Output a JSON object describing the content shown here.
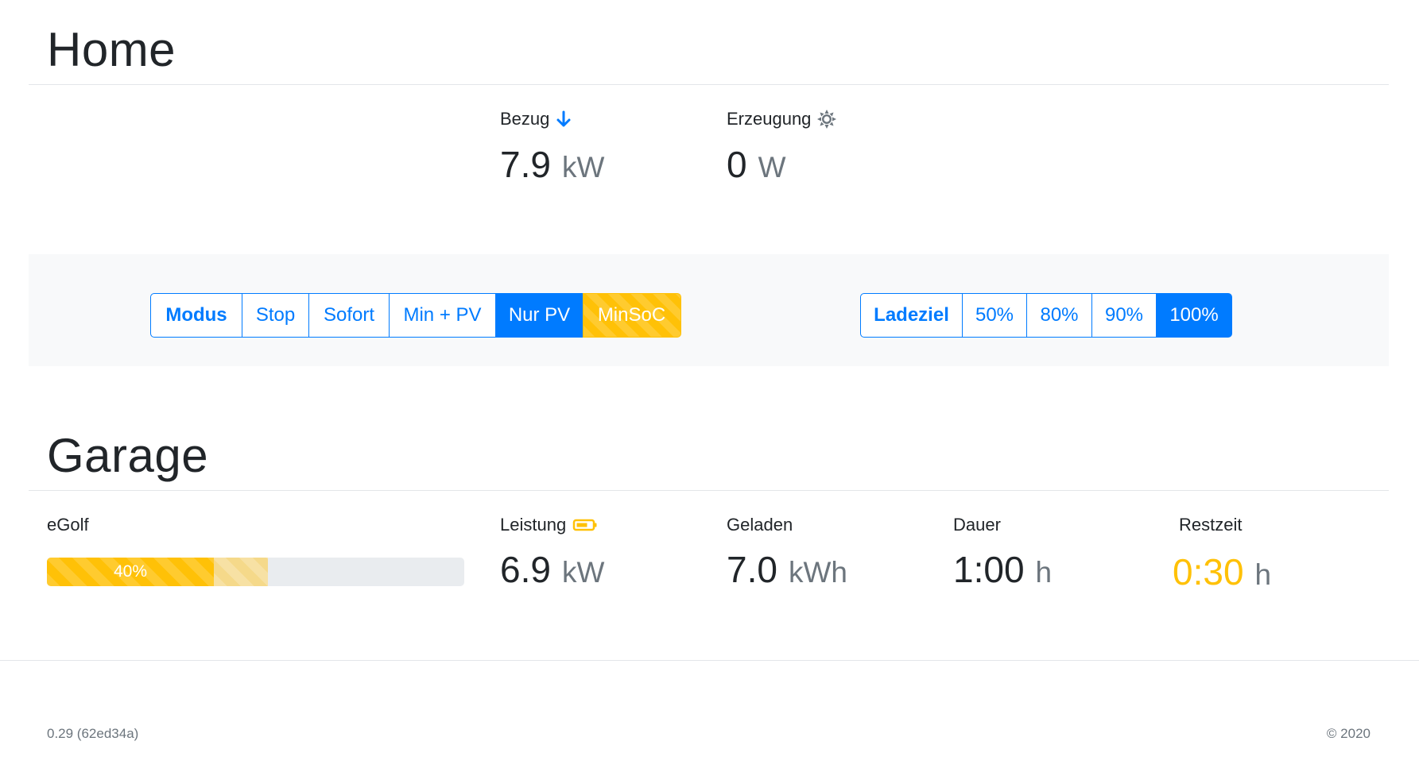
{
  "home": {
    "title": "Home",
    "bezug": {
      "label": "Bezug",
      "icon": "arrow-down-icon",
      "value": "7.9",
      "unit": "kW"
    },
    "erzeugung": {
      "label": "Erzeugung",
      "icon": "sun-icon",
      "value": "0",
      "unit": "W"
    }
  },
  "controls": {
    "mode": {
      "label": "Modus",
      "options": [
        "Stop",
        "Sofort",
        "Min + PV",
        "Nur PV"
      ],
      "selected": "Nur PV",
      "minsoc": "MinSoC"
    },
    "target": {
      "label": "Ladeziel",
      "options": [
        "50%",
        "80%",
        "90%",
        "100%"
      ],
      "selected": "100%"
    }
  },
  "garage": {
    "title": "Garage",
    "vehicle": {
      "name": "eGolf",
      "soc_label": "40%",
      "soc_fraction": 0.4,
      "target_fraction": 0.53
    },
    "leistung": {
      "label": "Leistung",
      "icon": "battery-charging-icon",
      "value": "6.9",
      "unit": "kW"
    },
    "geladen": {
      "label": "Geladen",
      "value": "7.0",
      "unit": "kWh"
    },
    "dauer": {
      "label": "Dauer",
      "value": "1:00",
      "unit": "h"
    },
    "restzeit": {
      "label": "Restzeit",
      "value": "0:30",
      "unit": "h"
    }
  },
  "footer": {
    "version": "0.29 (62ed34a)",
    "copyright": "© 2020"
  },
  "colors": {
    "primary": "#007bff",
    "warning": "#ffc107",
    "muted": "#6c757d"
  }
}
